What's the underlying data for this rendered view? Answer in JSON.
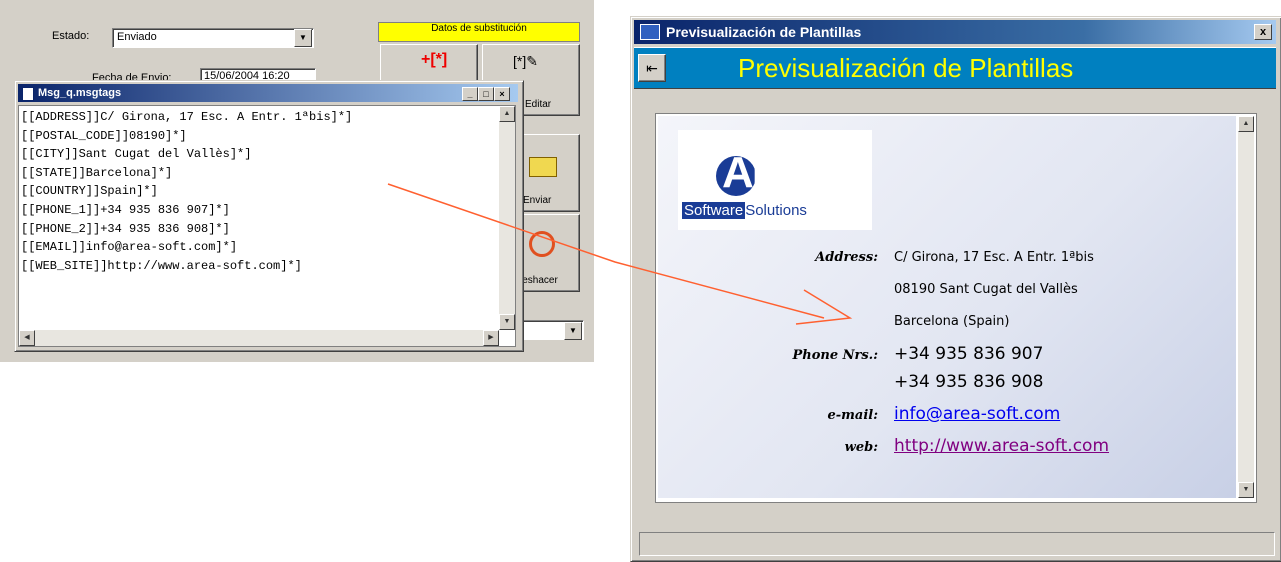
{
  "background_app": {
    "estado_label": "Estado:",
    "estado_value": "Enviado",
    "fecha_label": "Fecha de Envio:",
    "fecha_value": "15/06/2004 16:20",
    "datos_strip": "Datos de substitución",
    "editar_label": "Editar",
    "enviar_label": "Enviar",
    "deshacer_label": "Deshacer"
  },
  "msg_window": {
    "title": "Msg_q.msgtags",
    "lines": [
      "[[ADDRESS]]C/ Girona, 17 Esc. A Entr. 1ªbis]*]",
      "[[POSTAL_CODE]]08190]*]",
      "[[CITY]]Sant Cugat del Vallès]*]",
      "[[STATE]]Barcelona]*]",
      "[[COUNTRY]]Spain]*]",
      "[[PHONE_1]]+34 935 836 907]*]",
      "[[PHONE_2]]+34 935 836 908]*]",
      "[[EMAIL]]info@area-soft.com]*]",
      "[[WEB_SITE]]http://www.area-soft.com]*]"
    ]
  },
  "preview_window": {
    "title": "Previsualización de Plantillas",
    "banner_title": "Previsualización de Plantillas",
    "close_label": "x",
    "logo_main": "AREA",
    "logo_sub1": "Software",
    "logo_sub2": "Solutions",
    "fields": {
      "address_label": "Address:",
      "address_line1": "C/ Girona, 17 Esc. A Entr. 1ªbis",
      "address_line2": "08190 Sant Cugat del Vallès",
      "address_line3": "Barcelona (Spain)",
      "phone_label": "Phone Nrs.:",
      "phone1": "+34 935 836 907",
      "phone2": "+34 935 836 908",
      "email_label": "e-mail:",
      "email": "info@area-soft.com",
      "web_label": "web:",
      "web": "http://www.area-soft.com"
    }
  },
  "colors": {
    "title_gradient_start": "#0a246a",
    "banner_bg": "#0080c0",
    "banner_text": "#ffff00",
    "email_link": "#0000ee",
    "web_link": "#800080",
    "arrow": "#ff6030",
    "logo_blue": "#1a3c96"
  }
}
